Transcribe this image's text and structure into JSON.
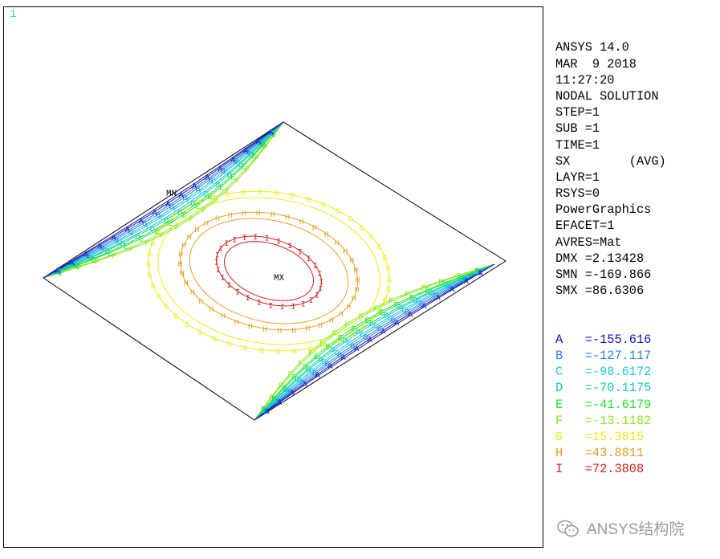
{
  "window_number": "1",
  "info": [
    "ANSYS 14.0",
    "MAR  9 2018",
    "11:27:20",
    "NODAL SOLUTION",
    "STEP=1",
    "SUB =1",
    "TIME=1",
    "SX        (AVG)",
    "LAYR=1",
    "RSYS=0",
    "PowerGraphics",
    "EFACET=1",
    "AVRES=Mat",
    "DMX =2.13428",
    "SMN =-169.866",
    "SMX =86.6306"
  ],
  "legend": [
    {
      "letter": "A",
      "value": "=-155.616",
      "color": "#1414b4"
    },
    {
      "letter": "B",
      "value": "=-127.117",
      "color": "#2d82e0"
    },
    {
      "letter": "C",
      "value": "=-98.6172",
      "color": "#1ec8dc"
    },
    {
      "letter": "D",
      "value": "=-70.1175",
      "color": "#14c8b4"
    },
    {
      "letter": "E",
      "value": "=-41.6179",
      "color": "#1ee632"
    },
    {
      "letter": "F",
      "value": "=-13.1182",
      "color": "#8ce61e"
    },
    {
      "letter": "G",
      "value": "=15.3815",
      "color": "#ebeb1e"
    },
    {
      "letter": "H",
      "value": "=43.8811",
      "color": "#e6a01e"
    },
    {
      "letter": "I",
      "value": "=72.3808",
      "color": "#d21e1e"
    }
  ],
  "plot_labels": {
    "min": "MN",
    "max": "MX"
  },
  "watermark": "ANSYS结构院"
}
